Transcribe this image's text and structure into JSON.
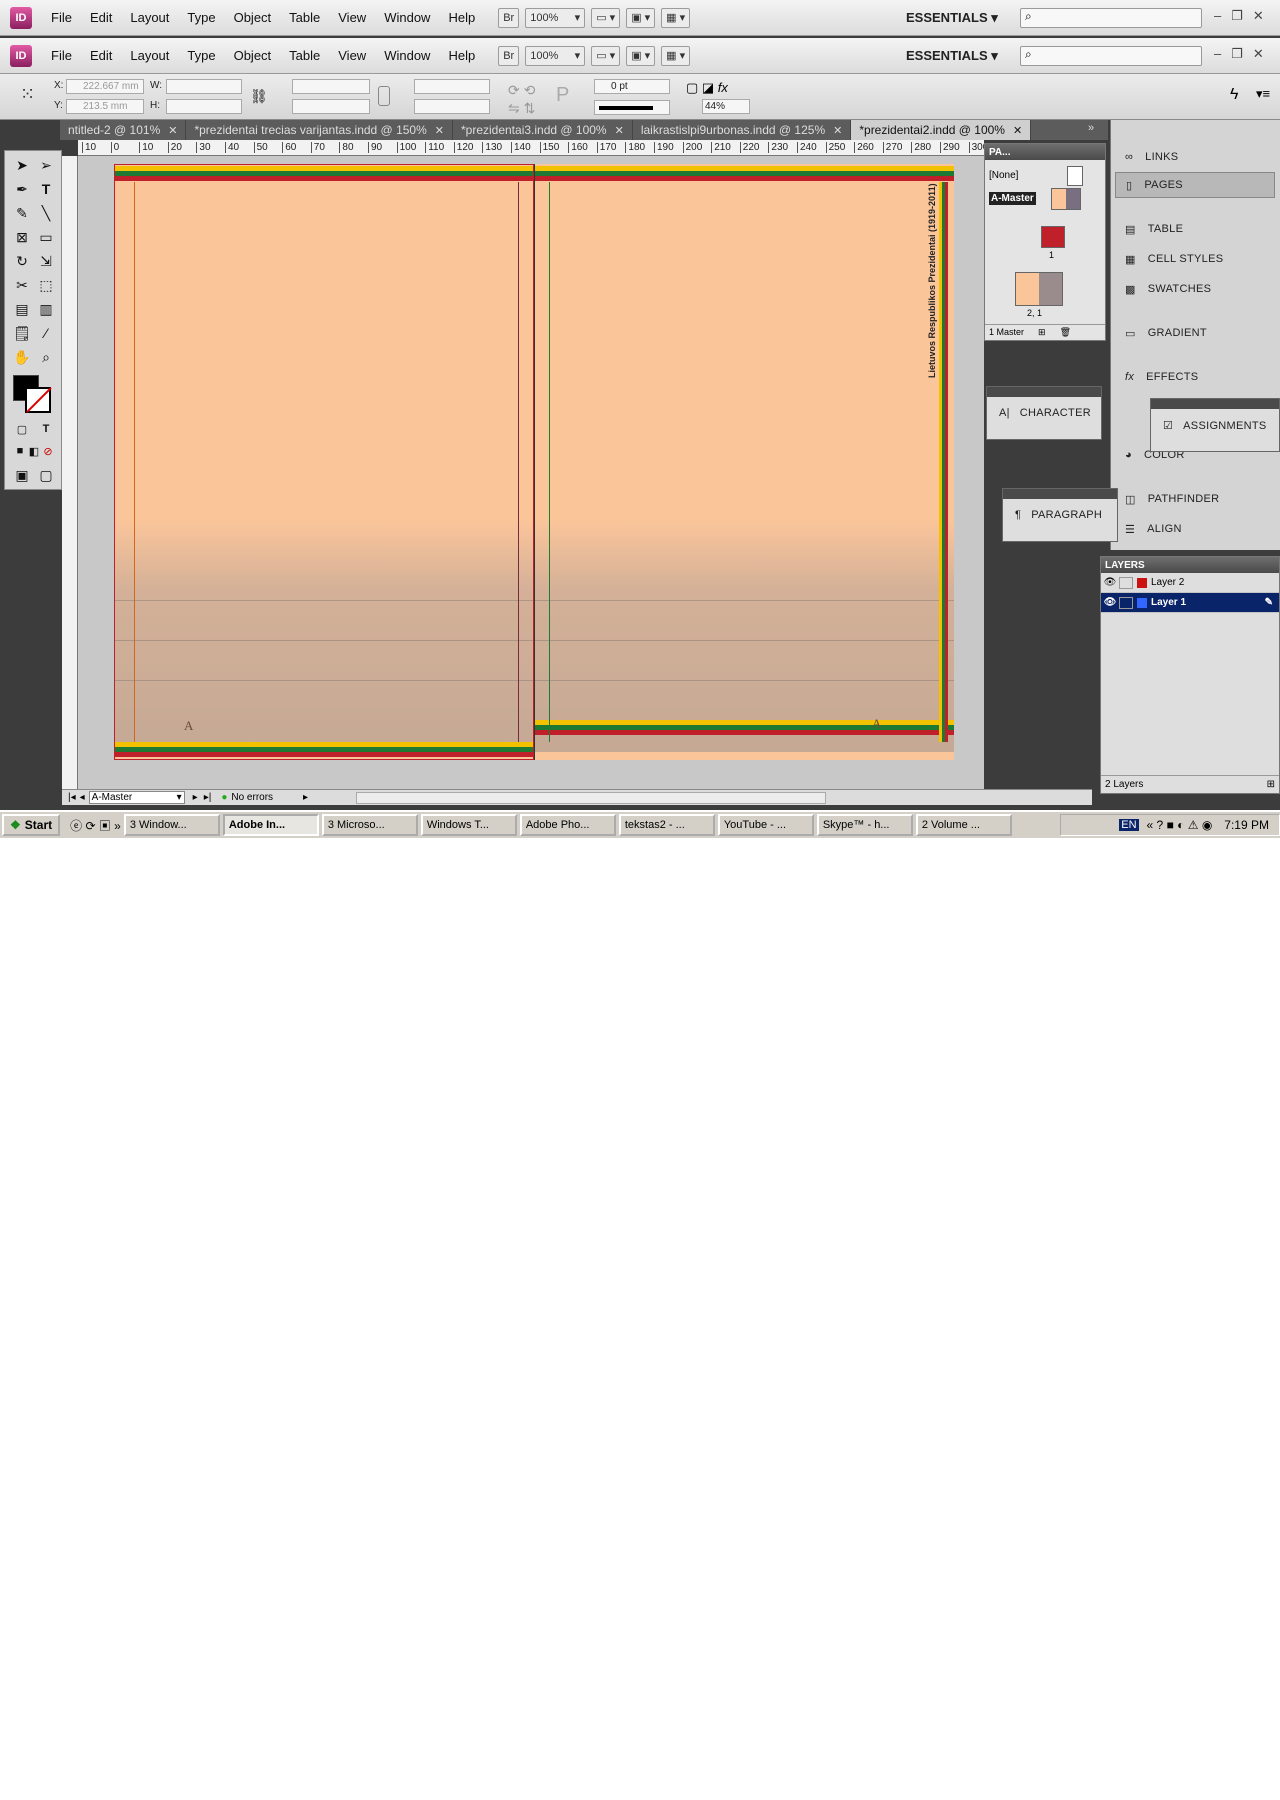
{
  "app": {
    "logo_text": "ID",
    "menu": [
      "File",
      "Edit",
      "Layout",
      "Type",
      "Object",
      "Table",
      "View",
      "Window",
      "Help"
    ],
    "bridge_label": "Br",
    "zoom": "100%",
    "workspace": "ESSENTIALS"
  },
  "control_panel": {
    "x_label": "X:",
    "x_value": "222.667 mm",
    "y_label": "Y:",
    "y_value": "213.5 mm",
    "w_label": "W:",
    "h_label": "H:",
    "stroke_weight": "0 pt",
    "opacity": "44%"
  },
  "tabs": [
    {
      "label": "ntitled-2 @ 101%"
    },
    {
      "label": "*prezidentai trecias  varijantas.indd @ 150%"
    },
    {
      "label": "*prezidentai3.indd @ 100%"
    },
    {
      "label": "laikrastislpi9urbonas.indd @ 125%"
    },
    {
      "label": "*prezidentai2.indd @ 100%"
    }
  ],
  "ruler_ticks": [
    "10",
    "0",
    "10",
    "20",
    "30",
    "40",
    "50",
    "60",
    "70",
    "80",
    "90",
    "100",
    "110",
    "120",
    "130",
    "140",
    "150",
    "160",
    "170",
    "180",
    "190",
    "200",
    "210",
    "220",
    "230",
    "240",
    "250",
    "260",
    "270",
    "280",
    "290",
    "300"
  ],
  "document": {
    "vertical_title": "Lietuvos Respublikos Prezidentai (1919-2011)",
    "left_page_marker": "A",
    "right_page_marker": "A"
  },
  "pages_panel": {
    "title": "PA...",
    "none_label": "[None]",
    "master_label": "A-Master",
    "page_1": "1",
    "spread_label": "2, 1",
    "footer": "1 Master"
  },
  "dock_panels": [
    "LINKS",
    "PAGES",
    "TABLE",
    "CELL STYLES",
    "SWATCHES",
    "GRADIENT",
    "EFFECTS",
    "COLOR",
    "PATHFINDER",
    "ALIGN"
  ],
  "floating_panels": {
    "character": "CHARACTER",
    "paragraph": "PARAGRAPH",
    "assignments": "ASSIGNMENTS"
  },
  "layers_panel": {
    "title": "LAYERS",
    "layers": [
      {
        "name": "Layer 2",
        "color": "#cc1111"
      },
      {
        "name": "Layer 1",
        "color": "#3366ff"
      }
    ],
    "footer": "2 Layers"
  },
  "status_bar": {
    "page": "A-Master",
    "preflight": "No errors"
  },
  "taskbar": {
    "start": "Start",
    "items": [
      "3 Window...",
      "Adobe In...",
      "3 Microso...",
      "Windows T...",
      "Adobe Pho...",
      "tekstas2 - ...",
      "YouTube - ...",
      "Skype™ - h...",
      "2 Volume ..."
    ],
    "lang": "EN",
    "time": "7:19 PM"
  },
  "colors": {
    "page": "#fbc59a",
    "flag_yellow": "#f2c200",
    "flag_green": "#1e7a32",
    "flag_red": "#c0202a",
    "selection": "#0a246a"
  }
}
